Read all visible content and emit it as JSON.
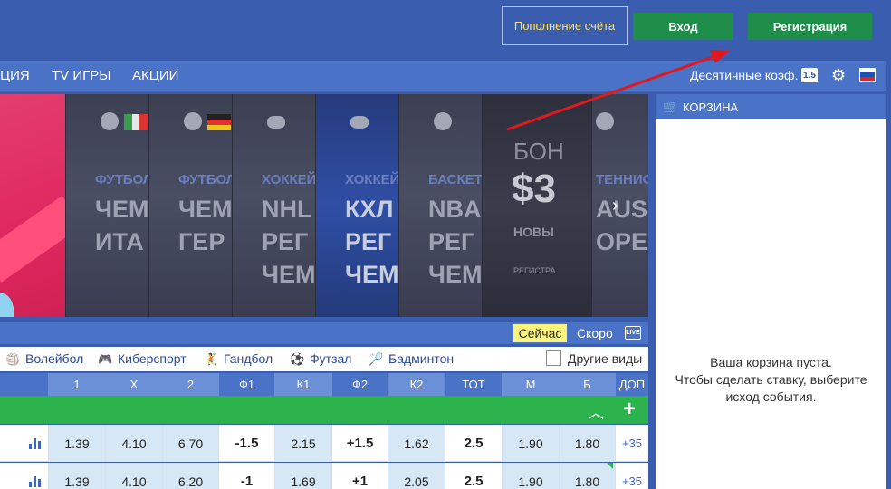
{
  "header": {
    "topup_label": "Пополнение счёта",
    "login_label": "Вход",
    "register_label": "Регистрация"
  },
  "nav": {
    "items": [
      {
        "label": "ЦИЯ"
      },
      {
        "label": "TV ИГРЫ"
      },
      {
        "label": "АКЦИИ"
      }
    ],
    "odds_format": "Десятичные коэф.",
    "odds_badge": "1.5"
  },
  "banner": {
    "cards": [
      {
        "sport": "ФУТБОЛ",
        "lines": [
          "ЧЕМ",
          "ИТА"
        ]
      },
      {
        "sport": "ФУТБОЛ",
        "lines": [
          "ЧЕМ",
          "ГЕР"
        ]
      },
      {
        "sport": "ХОККЕЙ",
        "lines": [
          "NHL",
          "РЕГ",
          "ЧЕМ"
        ]
      },
      {
        "sport": "ХОККЕЙ",
        "lines": [
          "КХЛ",
          "РЕГ",
          "ЧЕМ"
        ]
      },
      {
        "sport": "БАСКЕТ",
        "lines": [
          "NBA",
          "РЕГ",
          "ЧЕМ"
        ]
      },
      {
        "sport": "ТЕННИС",
        "lines": [
          "AUS",
          "OPE"
        ]
      }
    ],
    "bonus": {
      "top": "БОН",
      "big": "$3",
      "sub": "НОВЫ",
      "foot": "РЕГИСТРА"
    },
    "next_arrow": "›"
  },
  "filter": {
    "now": "Сейчас",
    "soon": "Скоро",
    "live": "LIVE"
  },
  "sports": [
    {
      "icon": "🏐",
      "label": "Волейбол"
    },
    {
      "icon": "🎮",
      "label": "Киберспорт"
    },
    {
      "icon": "🤾",
      "label": "Гандбол"
    },
    {
      "icon": "⚽",
      "label": "Футзал"
    },
    {
      "icon": "🏸",
      "label": "Бадминтон"
    }
  ],
  "other_sports": "Другие виды",
  "table": {
    "headers": [
      "1",
      "X",
      "2",
      "Ф1",
      "К1",
      "Ф2",
      "К2",
      "ТОТ",
      "М",
      "Б",
      "ДОП"
    ],
    "rows": [
      [
        "1.39",
        "4.10",
        "6.70",
        "-1.5",
        "2.15",
        "+1.5",
        "1.62",
        "2.5",
        "1.90",
        "1.80",
        "+35"
      ],
      [
        "1.39",
        "4.10",
        "6.20",
        "-1",
        "1.69",
        "+1",
        "2.05",
        "2.5",
        "1.90",
        "1.80",
        "+35"
      ]
    ]
  },
  "cart": {
    "title": "КОРЗИНА",
    "empty_line1": "Ваша корзина пуста.",
    "empty_line2": "Чтобы сделать ставку, выберите",
    "empty_line3": "исход события."
  },
  "colors": {
    "brand": "#3b5daf",
    "green": "#2bb24c",
    "highlight": "#fff47a",
    "annotation": "#e0191f"
  }
}
